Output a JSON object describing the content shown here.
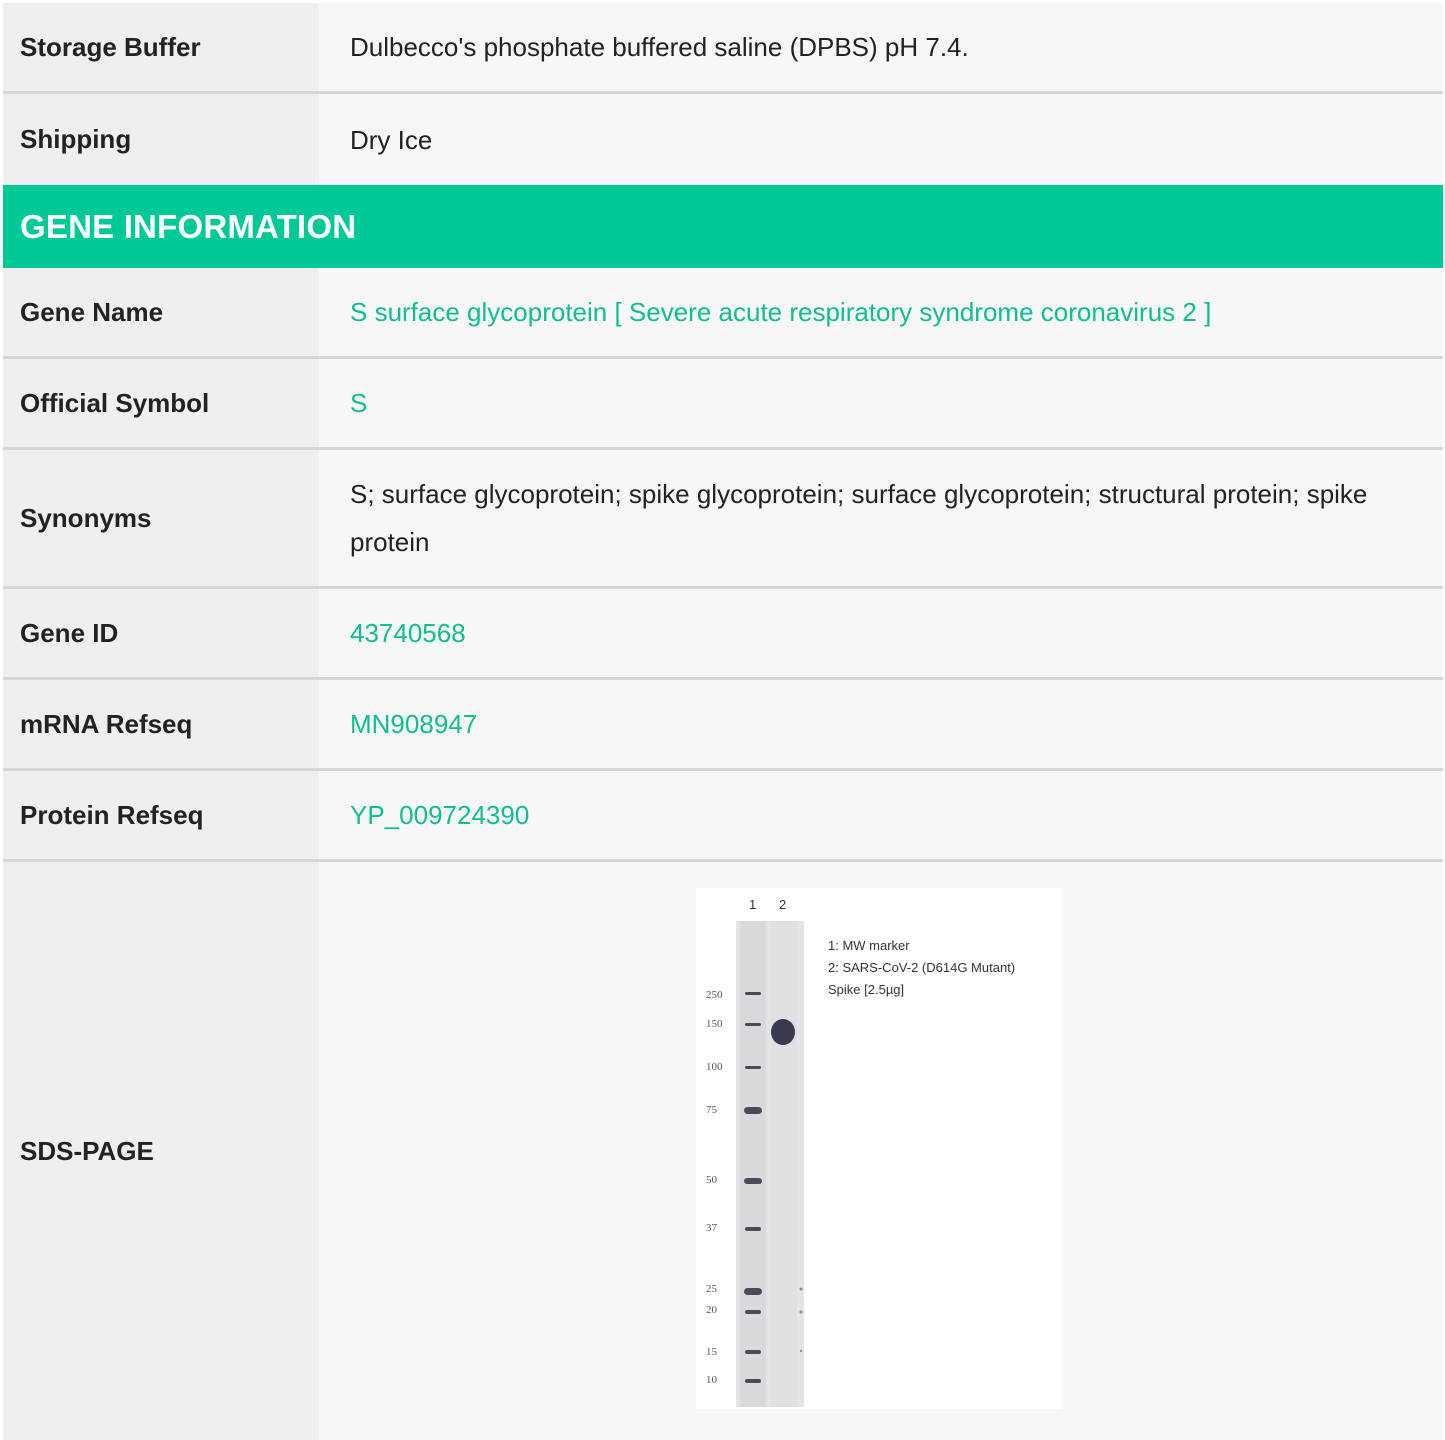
{
  "product_rows": [
    {
      "label": "Storage Buffer",
      "value": "Dulbecco's phosphate buffered saline (DPBS) pH 7.4."
    },
    {
      "label": "Shipping",
      "value": "Dry Ice"
    }
  ],
  "gene_section": {
    "title": "GENE INFORMATION",
    "gene_name_label": "Gene Name",
    "gene_name_value": "S surface glycoprotein [ Severe acute respiratory syndrome coronavirus 2 ]",
    "official_symbol_label": "Official Symbol",
    "official_symbol_value": "S",
    "synonyms_label": "Synonyms",
    "synonyms_value": "S; surface glycoprotein; spike glycoprotein; surface glycoprotein; structural protein; spike protein",
    "gene_id_label": "Gene ID",
    "gene_id_value": "43740568",
    "mrna_label": "mRNA Refseq",
    "mrna_value": "MN908947",
    "protein_label": "Protein Refseq",
    "protein_value": "YP_009724390",
    "sds_label": "SDS-PAGE"
  },
  "gel": {
    "lane_labels": [
      "1",
      "2"
    ],
    "legend": [
      "1: MW marker",
      "2: SARS-CoV-2 (D614G Mutant)",
      "Spike [2.5µg]"
    ],
    "marker_kda": [
      "250",
      "150",
      "100",
      "75",
      "50",
      "37",
      "25",
      "20",
      "15",
      "10"
    ]
  },
  "colors": {
    "accent": "#00c896",
    "link": "#0fbf91",
    "label_bg": "#efefef",
    "value_bg": "#f7f7f7",
    "divider": "#d6d6d6"
  }
}
